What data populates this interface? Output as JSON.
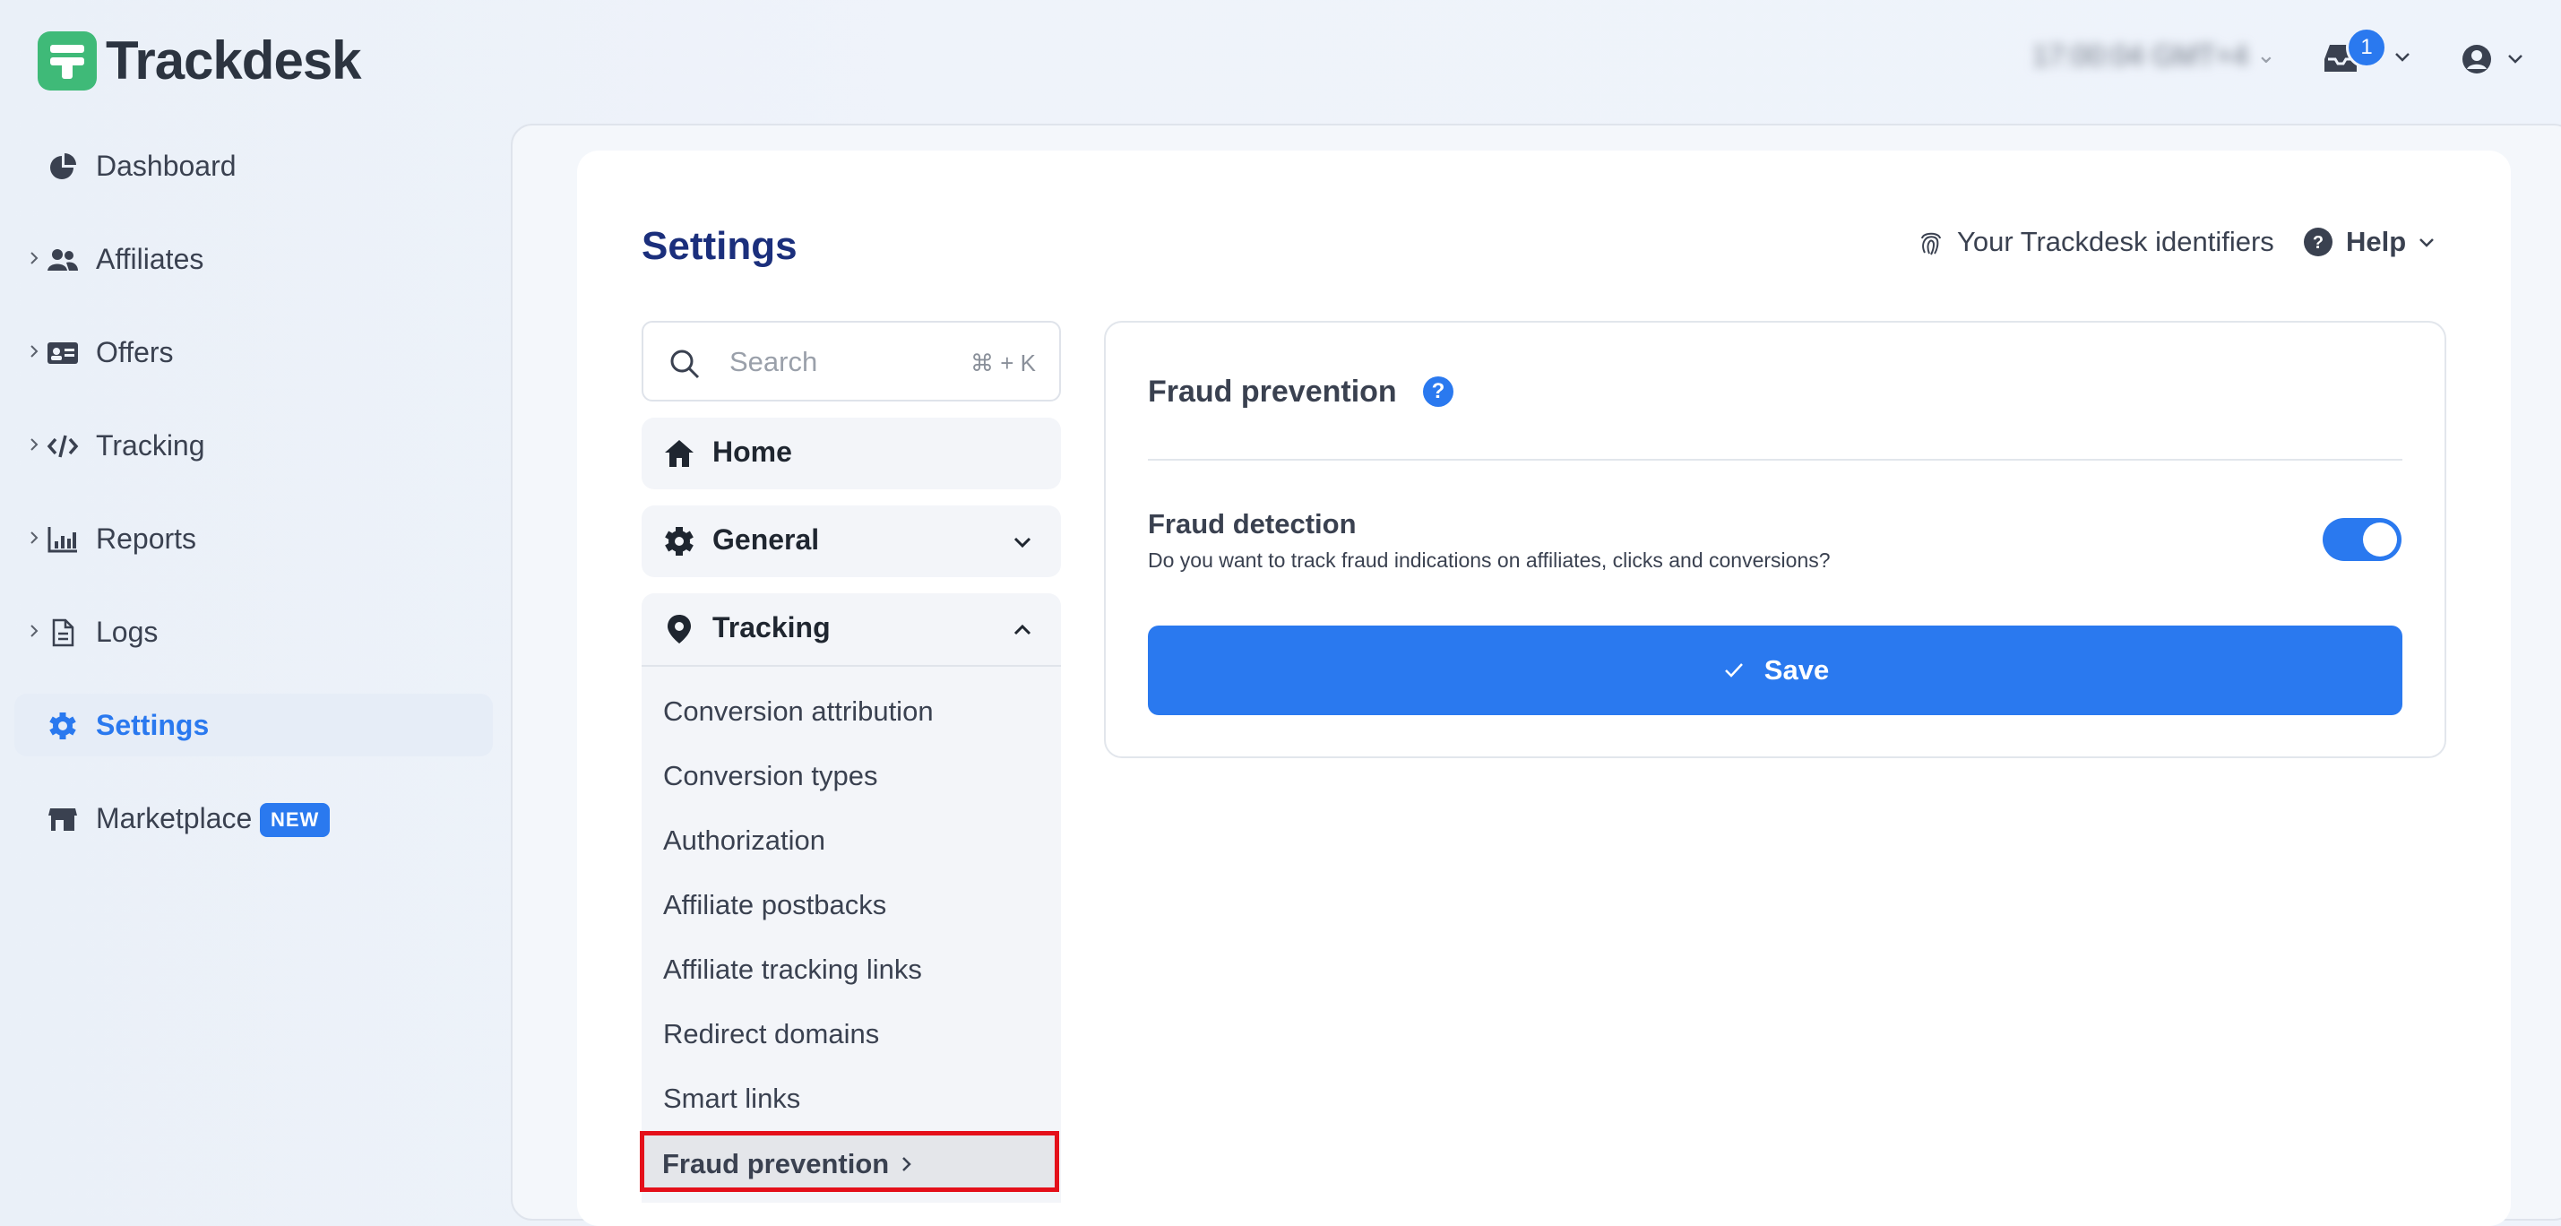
{
  "brand": {
    "name": "Trackdesk",
    "color": "#3fba78",
    "accent": "#2a79ef"
  },
  "topbar": {
    "clock": "17:00:04 GMT+4",
    "notifications_count": "1"
  },
  "sidebar": {
    "items": [
      {
        "label": "Dashboard",
        "icon": "pie-chart-icon"
      },
      {
        "label": "Affiliates",
        "icon": "users-icon"
      },
      {
        "label": "Offers",
        "icon": "id-card-icon"
      },
      {
        "label": "Tracking",
        "icon": "code-icon"
      },
      {
        "label": "Reports",
        "icon": "bar-chart-icon"
      },
      {
        "label": "Logs",
        "icon": "document-icon"
      },
      {
        "label": "Settings",
        "icon": "gear-icon"
      },
      {
        "label": "Marketplace",
        "icon": "store-icon",
        "badge": "NEW"
      }
    ]
  },
  "settings": {
    "title": "Settings",
    "identifiers_label": "Your Trackdesk identifiers",
    "help_label": "Help",
    "search": {
      "placeholder": "Search",
      "shortcut": "⌘ + K"
    },
    "menu": {
      "home": "Home",
      "general": "General",
      "tracking": "Tracking",
      "tracking_items": [
        "Conversion attribution",
        "Conversion types",
        "Authorization",
        "Affiliate postbacks",
        "Affiliate tracking links",
        "Redirect domains",
        "Smart links"
      ],
      "active_item": "Fraud prevention"
    }
  },
  "fraud": {
    "title": "Fraud prevention",
    "detection_title": "Fraud detection",
    "detection_desc": "Do you want to track fraud indications on affiliates, clicks and conversions?",
    "detection_enabled": true,
    "save_label": "Save"
  }
}
